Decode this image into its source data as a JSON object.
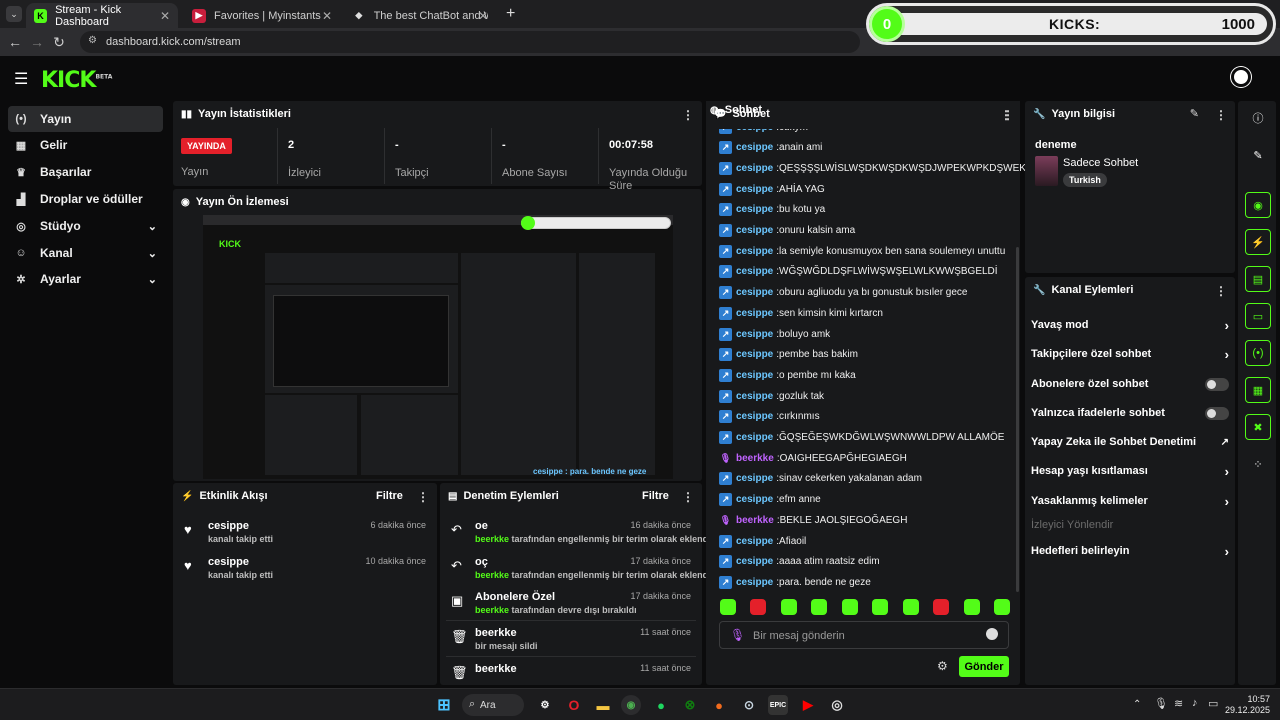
{
  "browser": {
    "tabs": [
      {
        "title": "Stream - Kick Dashboard",
        "active": true
      },
      {
        "title": "Favorites | Myinstants",
        "active": false
      },
      {
        "title": "The best ChatBot and Widgets",
        "active": false
      }
    ],
    "new_tab": "+",
    "url": "dashboard.kick.com/stream"
  },
  "overlay": {
    "current": "0",
    "label": "KICKS:",
    "goal": "1000"
  },
  "app": {
    "logo": "KICK",
    "logo_sup": "BETA"
  },
  "sidebar": {
    "items": [
      {
        "label": "Yayın",
        "icon": "broadcast-icon",
        "active": true
      },
      {
        "label": "Gelir",
        "icon": "revenue-icon"
      },
      {
        "label": "Başarılar",
        "icon": "trophy-icon"
      },
      {
        "label": "Droplar ve ödüller",
        "icon": "drops-icon"
      },
      {
        "label": "Stüdyo",
        "icon": "studio-icon",
        "expandable": true
      },
      {
        "label": "Kanal",
        "icon": "channel-icon",
        "expandable": true
      },
      {
        "label": "Ayarlar",
        "icon": "settings-icon",
        "expandable": true
      }
    ]
  },
  "stats": {
    "title": "Yayın İstatistikleri",
    "live_badge": "YAYINDA",
    "items": [
      {
        "value": "",
        "label": "Yayın"
      },
      {
        "value": "2",
        "label": "İzleyici"
      },
      {
        "value": "-",
        "label": "Takipçi"
      },
      {
        "value": "-",
        "label": "Abone Sayısı"
      },
      {
        "value": "00:07:58",
        "label": "Yayında Olduğu Süre"
      }
    ]
  },
  "preview": {
    "title": "Yayın Ön İzlemesi"
  },
  "activity": {
    "title": "Etkinlik Akışı",
    "filter": "Filtre",
    "items": [
      {
        "user": "cesippe",
        "text": "kanalı takip etti",
        "time": "6 dakika önce"
      },
      {
        "user": "cesippe",
        "text": "kanalı takip etti",
        "time": "10 dakika önce"
      }
    ]
  },
  "moderation": {
    "title": "Denetim Eylemleri",
    "filter": "Filtre",
    "items": [
      {
        "title": "oe",
        "actor": "beerkke",
        "text": "tarafından engellenmiş bir terim olarak eklendi",
        "time": "16 dakika önce"
      },
      {
        "title": "oç",
        "actor": "beerkke",
        "text": "tarafından engellenmiş bir terim olarak eklendi",
        "time": "17 dakika önce"
      },
      {
        "title": "Abonelere Özel",
        "actor": "beerkke",
        "text": "tarafından devre dışı bırakıldı",
        "time": "17 dakika önce"
      },
      {
        "title": "beerkke",
        "actor": "",
        "text": "bir mesajı sildi",
        "time": "11 saat önce"
      },
      {
        "title": "beerkke",
        "actor": "",
        "text": "",
        "time": "11 saat önce"
      }
    ]
  },
  "chat": {
    "title": "Sohbet",
    "messages": [
      {
        "user": "cesippe",
        "text": "cukym",
        "role": "blue"
      },
      {
        "user": "cesippe",
        "text": "anain ami",
        "role": "blue"
      },
      {
        "user": "cesippe",
        "text": "QEŞŞŞŞLWİSLWŞDKWŞDKWŞDJWPEKWPKDŞWEK",
        "role": "blue"
      },
      {
        "user": "cesippe",
        "text": "AHİA YAG",
        "role": "blue"
      },
      {
        "user": "cesippe",
        "text": "bu kotu ya",
        "role": "blue"
      },
      {
        "user": "cesippe",
        "text": "onuru kalsin ama",
        "role": "blue"
      },
      {
        "user": "cesippe",
        "text": "la semiyle konusmuyox ben sana soulemeyı unuttu",
        "role": "blue"
      },
      {
        "user": "cesippe",
        "text": "WĞŞWĞDLDŞFLWİWŞWŞELWLKWWŞBGELDİ",
        "role": "blue"
      },
      {
        "user": "cesippe",
        "text": "oburu agliuodu ya bı gonustuk bısıler gece",
        "role": "blue"
      },
      {
        "user": "cesippe",
        "text": "sen kimsin kimi kırtarcn",
        "role": "blue"
      },
      {
        "user": "cesippe",
        "text": "boluyo amk",
        "role": "blue"
      },
      {
        "user": "cesippe",
        "text": "pembe bas bakim",
        "role": "blue"
      },
      {
        "user": "cesippe",
        "text": "o pembe mı kaka",
        "role": "blue"
      },
      {
        "user": "cesippe",
        "text": "gozluk tak",
        "role": "blue"
      },
      {
        "user": "cesippe",
        "text": "cırkınmıs",
        "role": "blue"
      },
      {
        "user": "cesippe",
        "text": "ĞQŞEĞEŞWKDĞWLWŞWNWWLDPW ALLAMÖE",
        "role": "blue"
      },
      {
        "user": "beerkke",
        "text": "OAIGHEEGAPĞHEGIAEGH",
        "role": "mic"
      },
      {
        "user": "cesippe",
        "text": "sinav cekerken yakalanan adam",
        "role": "blue"
      },
      {
        "user": "cesippe",
        "text": "efm anne",
        "role": "blue"
      },
      {
        "user": "beerkke",
        "text": "BEKLE JAOLŞIEGOĞAEGH",
        "role": "mic"
      },
      {
        "user": "cesippe",
        "text": "Afiaoil",
        "role": "blue"
      },
      {
        "user": "cesippe",
        "text": "aaaa atim raatsiz edim",
        "role": "blue"
      },
      {
        "user": "cesippe",
        "text": "para. bende ne geze",
        "role": "blue"
      }
    ],
    "input_placeholder": "Bir mesaj gönderin",
    "send": "Gönder"
  },
  "stream_info": {
    "title": "Yayın bilgisi",
    "stream_title": "deneme",
    "category": "Sadece Sohbet",
    "tag": "Turkish"
  },
  "channel_actions": {
    "title": "Kanal Eylemleri",
    "items": [
      {
        "label": "Yavaş mod",
        "control": "chevron"
      },
      {
        "label": "Takipçilere özel sohbet",
        "control": "chevron"
      },
      {
        "label": "Abonelere özel sohbet",
        "control": "toggle"
      },
      {
        "label": "Yalnızca ifadelerle sohbet",
        "control": "toggle"
      },
      {
        "label": "Yapay Zeka ile Sohbet Denetimi",
        "control": "external"
      },
      {
        "label": "Hesap yaşı kısıtlaması",
        "control": "chevron"
      },
      {
        "label": "Yasaklanmış kelimeler",
        "control": "chevron"
      },
      {
        "label": "İzleyici Yönlendir",
        "control": "disabled"
      },
      {
        "label": "Hedefleri belirleyin",
        "control": "chevron"
      }
    ]
  },
  "taskbar": {
    "search": "Ara",
    "time": "10:57",
    "date": "29.12.2025"
  },
  "colors": {
    "accent": "#53fc18",
    "live": "#e4202a",
    "panel": "#18191b",
    "chat_user": "#6cc7ff",
    "mod_user": "#c063ff"
  }
}
